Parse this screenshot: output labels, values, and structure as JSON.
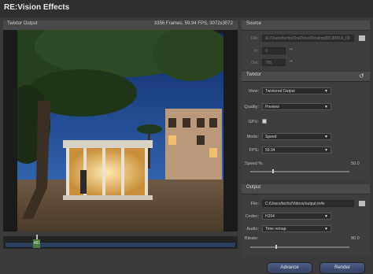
{
  "app": {
    "title": "RE:Vision Effects"
  },
  "viewer": {
    "header_left": "Twixtor Output",
    "header_right": "3356 Frames, 59.94 FPS, 3072x3072"
  },
  "timeline": {
    "current_frame": "481",
    "position": 0.14
  },
  "source": {
    "section_title": "Source",
    "file_label": "File:",
    "file_value": "/E:/Users/techs/OneDrive/Desktop/DCIM/DJI_00",
    "in_label": "In:",
    "in_value": "0",
    "out_label": "Out:",
    "out_value": "765"
  },
  "twixtor": {
    "section_title": "Twixtor",
    "view_label": "View:",
    "view_value": "Twixtored Output",
    "quality_label": "Quality:",
    "quality_value": "Preview",
    "gpu_label": "GPU:",
    "gpu_checked": true,
    "mode_label": "Mode:",
    "mode_value": "Speed",
    "fps_label": "FPS:",
    "fps_value": "59.94",
    "speed_label": "Speed %:",
    "speed_value": "50.0"
  },
  "output": {
    "section_title": "Output",
    "file_label": "File:",
    "file_value": "C:/Users/techs/Videos/output.m4v",
    "codec_label": "Codec:",
    "codec_value": "H264",
    "audio_label": "Audio:",
    "audio_value": "Time remap",
    "bitrate_label": "Bitrate:",
    "bitrate_value": "80.0"
  },
  "buttons": {
    "advance": "Advance",
    "render": "Render"
  },
  "icons": {
    "reset": "reset-icon",
    "in_marker": "mark-in-icon",
    "out_marker": "mark-out-icon",
    "folder": "folder-icon",
    "dropdown": "chevron-down-icon"
  },
  "colors": {
    "accent": "#4b7a3d",
    "button": "#3c4a6e",
    "timeline": "#2d3f5e"
  }
}
